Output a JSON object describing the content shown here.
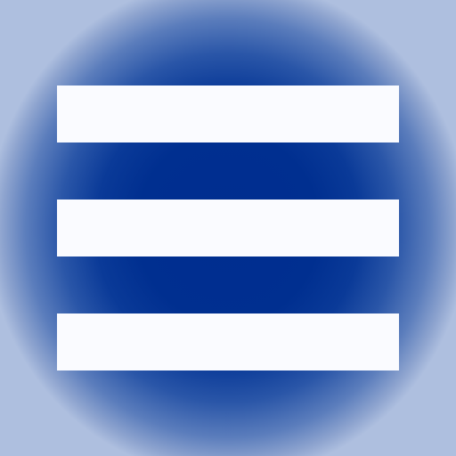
{
  "icon": {
    "name": "hamburger-menu-icon",
    "bar_count": 3,
    "colors": {
      "background_center": "#002d8f",
      "background_edge": "#aebfdf",
      "bars": "#fafbff"
    }
  }
}
